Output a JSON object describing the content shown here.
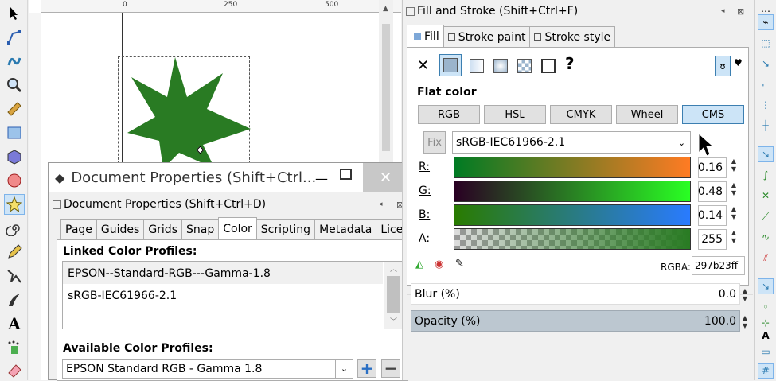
{
  "ruler": {
    "h_marks": [
      "0",
      "250",
      "500"
    ]
  },
  "doc_props": {
    "window_title": "Document Properties (Shift+Ctrl...",
    "panel_title": "Document Properties (Shift+Ctrl+D)",
    "tabs": [
      "Page",
      "Guides",
      "Grids",
      "Snap",
      "Color",
      "Scripting",
      "Metadata",
      "License"
    ],
    "active_tab": "Color",
    "linked_label": "Linked Color Profiles:",
    "linked_profiles": [
      "EPSON--Standard-RGB---Gamma-1.8",
      "sRGB-IEC61966-2.1"
    ],
    "available_label": "Available Color Profiles:",
    "available_selected": "EPSON  Standard RGB - Gamma 1.8",
    "add_symbol": "+",
    "remove_symbol": "−"
  },
  "fill_stroke": {
    "title": "Fill and Stroke (Shift+Ctrl+F)",
    "tabs": [
      "Fill",
      "Stroke paint",
      "Stroke style"
    ],
    "flat_color_label": "Flat color",
    "modes": [
      "RGB",
      "HSL",
      "CMYK",
      "Wheel",
      "CMS"
    ],
    "active_mode": "CMS",
    "fix_label": "Fix",
    "profile": "sRGB-IEC61966-2.1",
    "channels": [
      {
        "label": "R:",
        "value": "0.16"
      },
      {
        "label": "G:",
        "value": "0.48"
      },
      {
        "label": "B:",
        "value": "0.14"
      },
      {
        "label": "A:",
        "value": "255"
      }
    ],
    "rgba_label": "RGBA:",
    "rgba_value": "297b23ff",
    "blur_label": "Blur (%)",
    "blur_value": "0.0",
    "opacity_label": "Opacity (%)",
    "opacity_value": "100.0"
  },
  "colors": {
    "fill": "#297b23",
    "accent": "#3c7fb1"
  }
}
